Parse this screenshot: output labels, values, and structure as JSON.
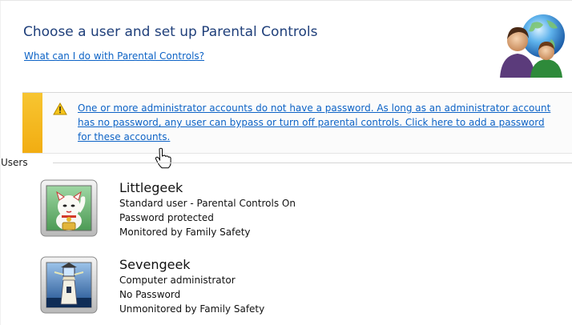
{
  "header": {
    "title": "Choose a user and set up Parental Controls",
    "help_link": "What can I do with Parental Controls?",
    "icon": "parental-controls-globe-users-icon"
  },
  "warning": {
    "icon": "warning-triangle-icon",
    "message": "One or more administrator accounts do not have a password. As long as an administrator account has no password, any user can bypass or turn off parental controls. Click here to add a password for these accounts.",
    "accent_color": "#f4b81f"
  },
  "users_section": {
    "label": "Users",
    "users": [
      {
        "name": "Littlegeek",
        "account_type": "Standard user - Parental Controls On",
        "password_status": "Password protected",
        "monitoring": "Monitored by Family Safety",
        "avatar": "lucky-cat-avatar-icon"
      },
      {
        "name": "Sevengeek",
        "account_type": "Computer administrator",
        "password_status": "No Password",
        "monitoring": "Unmonitored by Family Safety",
        "avatar": "lighthouse-avatar-icon"
      }
    ]
  },
  "colors": {
    "title": "#1f3f7a",
    "link": "#0d63c6"
  },
  "pointer": "hand-pointer-cursor-icon"
}
